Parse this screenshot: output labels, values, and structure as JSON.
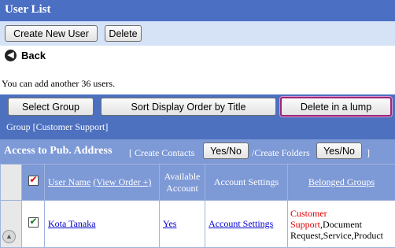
{
  "title": "User List",
  "toolbar": {
    "create_new_user": "Create New User",
    "delete": "Delete"
  },
  "back": {
    "label": "Back",
    "icon": "back-arrow-icon"
  },
  "info_text": "You can add another 36 users.",
  "actions": {
    "select_group": "Select Group",
    "sort_display_order": "Sort Display Order by Title",
    "delete_in_lump": "Delete in a lump"
  },
  "group_label": "Group [Customer Support]",
  "access": {
    "title": "Access to Pub. Address",
    "create_contacts_label": "[ Create Contacts",
    "create_contacts_btn": "Yes/No",
    "create_folders_label": "/Create Folders",
    "create_folders_btn": "Yes/No",
    "close_bracket": "]"
  },
  "table": {
    "headers": {
      "user_name": "User Name",
      "view_order": "(View Order +)",
      "available_account": "Available Account",
      "account_settings": "Account Settings",
      "belonged_groups": "Belonged Groups"
    },
    "rows": [
      {
        "checked": true,
        "user_name": "Kota Tanaka",
        "available": "Yes",
        "account_settings": "Account Settings",
        "group_highlight": "Customer Support",
        "group_rest": ",Document Request,Service,Product"
      }
    ]
  },
  "colors": {
    "header_bar": "#4a6fc3",
    "toolbar_bg": "#d6e3f6",
    "access_bar": "#7d99d6",
    "focus_border": "#a0267a"
  }
}
